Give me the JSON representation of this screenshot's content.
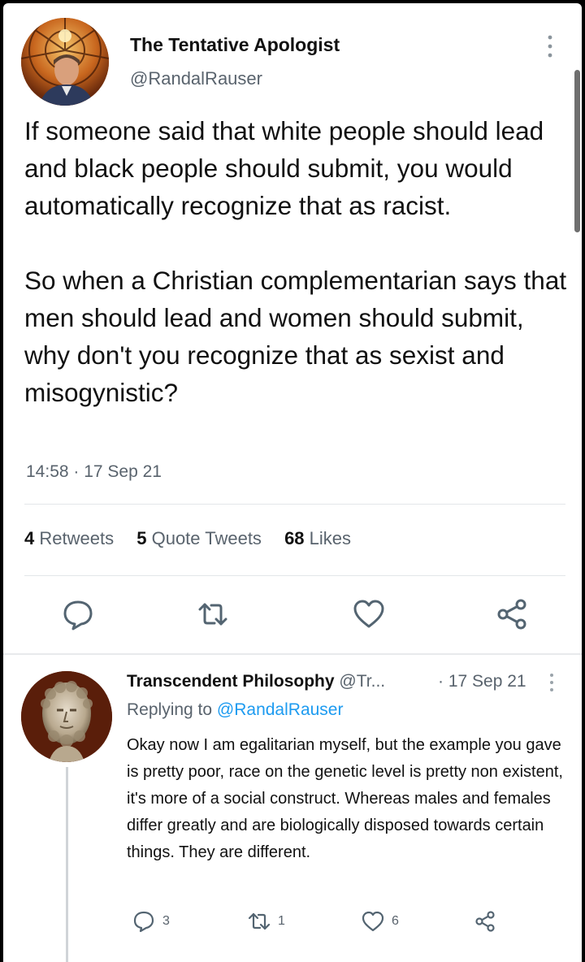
{
  "main_tweet": {
    "author_name": "The Tentative Apologist",
    "author_handle": "@RandalRauser",
    "text_paragraphs": [
      "If someone said that white people should lead and black people should submit, you would automatically recognize that as racist.",
      "So when a Christian complementarian says that men should lead and women should submit, why don't you recognize that as sexist and misogynistic?"
    ],
    "timestamp": "14:58 · 17 Sep 21",
    "stats": {
      "retweets_count": "4",
      "retweets_label": "Retweets",
      "quotes_count": "5",
      "quotes_label": "Quote Tweets",
      "likes_count": "68",
      "likes_label": "Likes"
    },
    "actions": [
      "reply-icon",
      "retweet-icon",
      "like-icon",
      "share-icon"
    ]
  },
  "reply": {
    "author_name": "Transcendent Philosophy",
    "author_handle": "@Tr...",
    "date": "· 17 Sep 21",
    "replying_prefix": "Replying to",
    "replying_handle": "@RandalRauser",
    "text": "Okay now I am egalitarian myself, but the example you gave is pretty poor, race on the genetic level is pretty non existent, it's more of a social construct. Whereas males and females differ greatly and are biologically disposed towards certain things. They are different.",
    "reply_count": "3",
    "retweet_count": "1",
    "like_count": "6"
  },
  "colors": {
    "text": "#0f1419",
    "secondary": "#59636d",
    "link": "#1d9bf0",
    "icon": "#536471",
    "divider": "#e3e6e9"
  }
}
